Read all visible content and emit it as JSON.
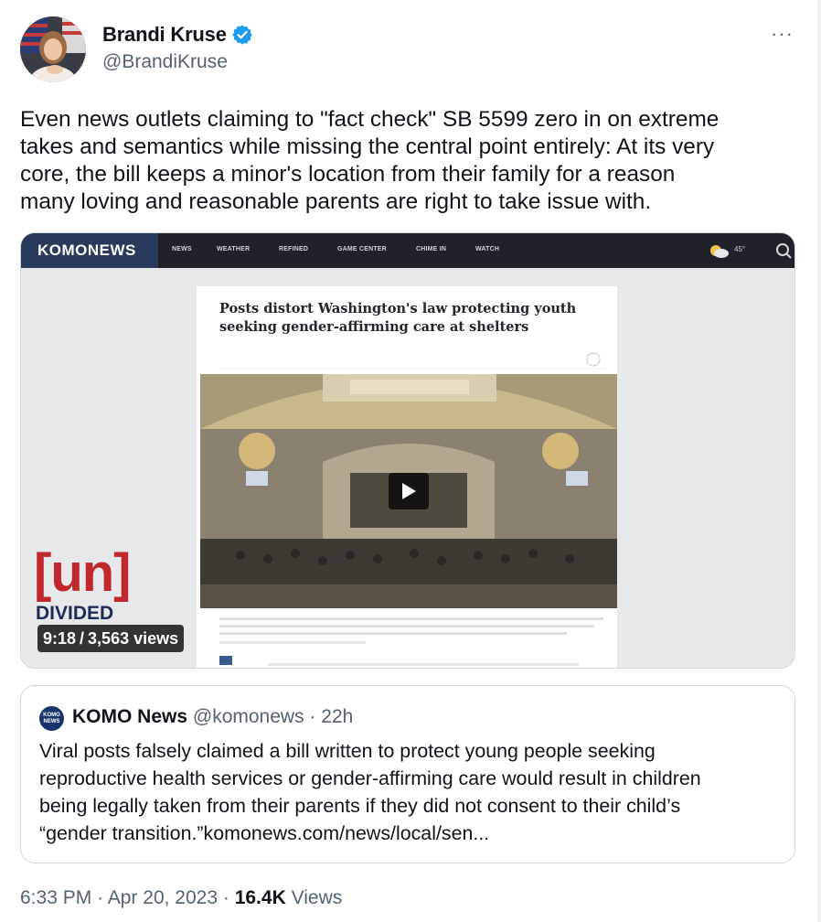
{
  "author": {
    "name": "Brandi Kruse",
    "handle": "@BrandiKruse",
    "verified_color": "#1d9bf0",
    "more_label": "···"
  },
  "tweet": {
    "lines": [
      "Even news outlets claiming to \"fact check\" SB 5599 zero in on extreme",
      "takes and semantics while missing the central point entirely: At its very",
      "core, the bill keeps a minor's location from their family for a reason",
      "many loving and reasonable parents are right to take issue with."
    ]
  },
  "media": {
    "site_brand": "KOMONEWS",
    "nav_items": [
      "NEWS",
      "WEATHER",
      "REFINED",
      "GAME CENTER",
      "CHIME IN",
      "WATCH"
    ],
    "temperature": "45°",
    "headline_lines": [
      "Posts distort Washington's law protecting youth",
      "seeking gender-affirming care at shelters"
    ],
    "show_mark": "[un]",
    "show_mark_sub": "DIVIDED",
    "duration": "9:18",
    "separator": "/",
    "views": "3,563 views"
  },
  "quote": {
    "logo_text": [
      "KOMO",
      "NEWS"
    ],
    "name": "KOMO News",
    "handle": "@komonews",
    "dot": "·",
    "age": "22h",
    "lines": [
      "Viral posts falsely claimed a bill written to protect young people seeking",
      "reproductive health services or gender-affirming care would result in children",
      "being legally taken from their parents if they did not consent to their child’s",
      "“gender transition.”komonews.com/news/local/sen..."
    ]
  },
  "footer": {
    "time": "6:33 PM",
    "dot1": "·",
    "date": "Apr 20, 2023",
    "dot2": "·",
    "views_count": "16.4K",
    "views_label": "Views"
  }
}
